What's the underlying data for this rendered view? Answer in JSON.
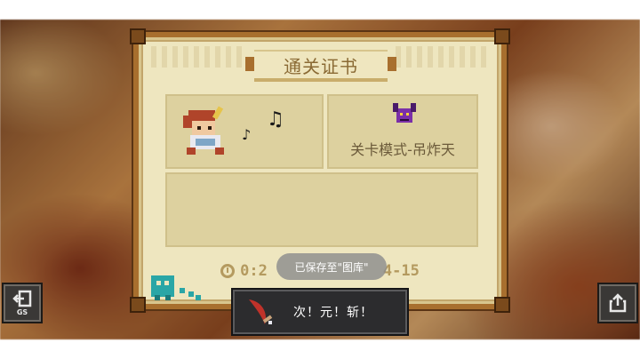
{
  "certificate": {
    "title": "通关证书",
    "mode_label": "关卡模式-吊炸天",
    "time_prefix": "0:2",
    "time_suffix": "4-15"
  },
  "toast": {
    "text": "已保存至\"图库\""
  },
  "achievement": {
    "label": "次！元！斩！",
    "icon": "crescent-blade-icon"
  },
  "buttons": {
    "exit_small_label": "GS",
    "exit_icon": "exit-door-icon",
    "share_icon": "share-upload-icon"
  },
  "colors": {
    "frame": "#a86f2e",
    "paper": "#eee6bf",
    "panel": "#ddd19f",
    "mode_icon": "#7a2fa8",
    "pet": "#2aa6a6"
  }
}
